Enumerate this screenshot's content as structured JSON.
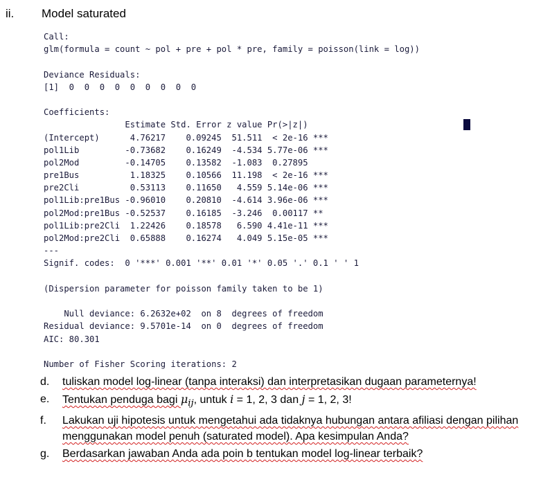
{
  "section": {
    "number": "ii.",
    "title": "Model saturated"
  },
  "output_lines": [
    "Call:",
    "glm(formula = count ~ pol + pre + pol * pre, family = poisson(link = log))",
    "",
    "Deviance Residuals:",
    "[1]  0  0  0  0  0  0  0  0  0",
    "",
    "Coefficients:",
    "                Estimate Std. Error z value Pr(>|z|)",
    "(Intercept)      4.76217    0.09245  51.511  < 2e-16 ***",
    "pol1Lib         -0.73682    0.16249  -4.534 5.77e-06 ***",
    "pol2Mod         -0.14705    0.13582  -1.083  0.27895",
    "pre1Bus          1.18325    0.10566  11.198  < 2e-16 ***",
    "pre2Cli          0.53113    0.11650   4.559 5.14e-06 ***",
    "pol1Lib:pre1Bus -0.96010    0.20810  -4.614 3.96e-06 ***",
    "pol2Mod:pre1Bus -0.52537    0.16185  -3.246  0.00117 **",
    "pol1Lib:pre2Cli  1.22426    0.18578   6.590 4.41e-11 ***",
    "pol2Mod:pre2Cli  0.65888    0.16274   4.049 5.15e-05 ***",
    "---",
    "Signif. codes:  0 '***' 0.001 '**' 0.01 '*' 0.05 '.' 0.1 ' ' 1",
    "",
    "(Dispersion parameter for poisson family taken to be 1)",
    "",
    "    Null deviance: 6.2632e+02  on 8  degrees of freedom",
    "Residual deviance: 9.5701e-14  on 0  degrees of freedom",
    "AIC: 80.301",
    "",
    "Number of Fisher Scoring iterations: 2"
  ],
  "questions": {
    "d": {
      "label": "d.",
      "text": "tuliskan model log-linear (tanpa interaksi) dan interpretasikan dugaan parameternya!"
    },
    "e": {
      "label": "e.",
      "pre": "Tentukan penduga bagi ",
      "mu": "μ",
      "sub": "ij",
      "mid": ", untuk ",
      "i_var": "i",
      "i_vals": " = 1, 2, 3 dan ",
      "j_var": "j",
      "j_vals": " = 1, 2, 3!"
    },
    "f": {
      "label": "f.",
      "text": "Lakukan uji hipotesis untuk mengetahui ada tidaknya hubungan antara afiliasi dengan pilihan menggunakan model penuh (saturated model). Apa kesimpulan Anda?"
    },
    "g": {
      "label": "g.",
      "text": "Berdasarkan jawaban Anda ada poin b tentukan model log-linear terbaik?"
    }
  }
}
